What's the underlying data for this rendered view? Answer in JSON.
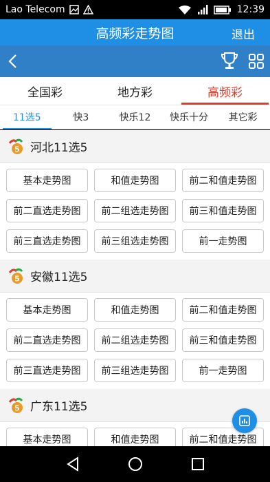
{
  "status_bar": {
    "carrier": "Lao Telecom",
    "time": "12:39"
  },
  "header": {
    "title": "高频彩走势图",
    "exit_label": "退出"
  },
  "nav": {
    "back_icon": "chevron-left-icon",
    "trophy_icon": "trophy-icon",
    "grid_icon": "grid-apps-icon"
  },
  "category_tabs": [
    {
      "label": "全国彩",
      "active": false
    },
    {
      "label": "地方彩",
      "active": false
    },
    {
      "label": "高频彩",
      "active": true
    }
  ],
  "sub_tabs": [
    {
      "label": "11选5",
      "active": true
    },
    {
      "label": "快3",
      "active": false
    },
    {
      "label": "快乐12",
      "active": false
    },
    {
      "label": "快乐十分",
      "active": false
    },
    {
      "label": "其它彩",
      "active": false
    }
  ],
  "sections": [
    {
      "name": "河北11选5",
      "buttons": [
        "基本走势图",
        "和值走势图",
        "前二和值走势图",
        "前二直选走势图",
        "前二组选走势图",
        "前三和值走势图",
        "前三直选走势图",
        "前三组选走势图",
        "前一走势图"
      ]
    },
    {
      "name": "安徽11选5",
      "buttons": [
        "基本走势图",
        "和值走势图",
        "前二和值走势图",
        "前二直选走势图",
        "前二组选走势图",
        "前三和值走势图",
        "前三直选走势图",
        "前三组选走势图",
        "前一走势图"
      ]
    },
    {
      "name": "广东11选5",
      "buttons": [
        "基本走势图",
        "和值走势图",
        "前二和值走势图"
      ]
    }
  ],
  "colors": {
    "title_bar": "#1f8fe5",
    "nav_bar": "#2f80c6",
    "active_red": "#e23b2a",
    "active_blue": "#1f8fe5"
  }
}
